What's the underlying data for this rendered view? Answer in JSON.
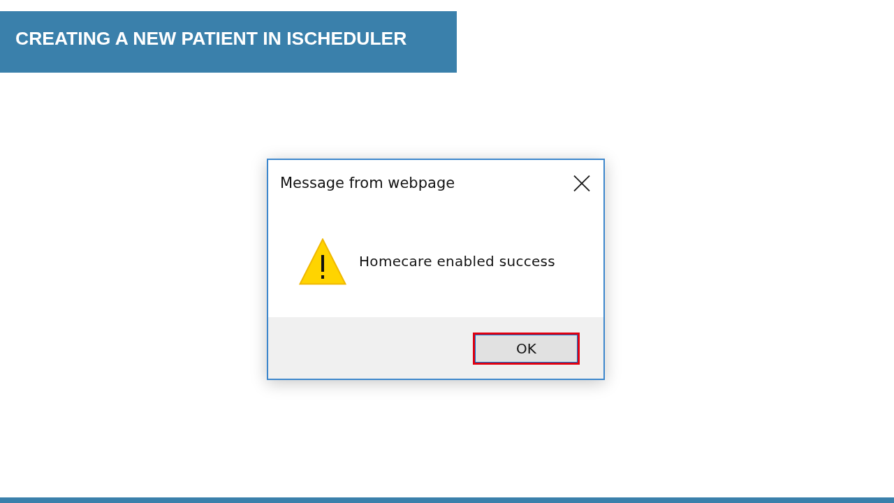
{
  "header": {
    "title": "CREATING A NEW PATIENT IN ISCHEDULER"
  },
  "dialog": {
    "title": "Message from webpage",
    "message": "Homecare enabled success",
    "buttons": [
      {
        "label": "OK",
        "focused": true,
        "highlighted": true
      }
    ]
  }
}
